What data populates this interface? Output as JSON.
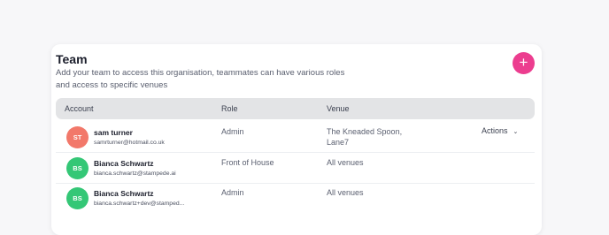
{
  "team": {
    "title": "Team",
    "subtitle_line1": "Add your team to access this organisation, teammates can have various roles",
    "subtitle_line2": "and access to specific venues",
    "add_label": "+"
  },
  "table": {
    "columns": [
      "Account",
      "Role",
      "Venue"
    ],
    "rows": [
      {
        "initials": "ST",
        "avatar_color": "#f2786a",
        "name": "sam turner",
        "email": "samrturner@hotmail.co.uk",
        "role": "Admin",
        "venue_line1": "The Kneaded Spoon,",
        "venue_line2": "Lane7",
        "actions_label": "Actions"
      },
      {
        "initials": "BS",
        "avatar_color": "#34c776",
        "name": "Bianca  Schwartz",
        "email": "bianca.schwartz@stampede.ai",
        "role": "Front of House",
        "venue_line1": "All venues"
      },
      {
        "initials": "BS",
        "avatar_color": "#34c776",
        "name": "Bianca Schwartz",
        "email": "bianca.schwartz+dev@stamped...",
        "role": "Admin",
        "venue_line1": "All venues"
      }
    ]
  },
  "colors": {
    "accent": "#ec3d8f",
    "header_bg": "#e3e4e6"
  },
  "icons": {
    "add": "plus-icon",
    "actions": "chevron-down-icon"
  }
}
